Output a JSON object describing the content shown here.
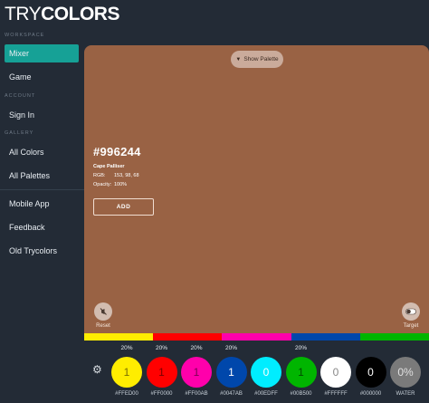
{
  "app": {
    "logo_part1": "TRY",
    "logo_part2": "COLORS"
  },
  "sidebar": {
    "sections": {
      "workspace": "WORKSPACE",
      "account": "ACCOUNT",
      "gallery": "GALLERY"
    },
    "items": [
      {
        "label": "Mixer",
        "active": true
      },
      {
        "label": "Game"
      },
      {
        "label": "Sign In"
      },
      {
        "label": "All Colors"
      },
      {
        "label": "All Palettes"
      },
      {
        "label": "Mobile App"
      },
      {
        "label": "Feedback"
      },
      {
        "label": "Old Trycolors"
      }
    ]
  },
  "card": {
    "bg_color": "#996244",
    "show_palette_label": "Show Palette",
    "hex": "#996244",
    "name": "Cape Palliser",
    "rgb_label": "RGB:",
    "rgb_value": "153, 98, 68",
    "opacity_label": "Opacity:",
    "opacity_value": "100%",
    "add_label": "ADD",
    "reset_label": "Reset",
    "target_label": "Target"
  },
  "strip_colors": [
    "#FFED00",
    "#FF0000",
    "#FF00AB",
    "#0047AB",
    "#00EDFF",
    "#00B500",
    "#FFFFFF"
  ],
  "swatches": [
    {
      "percent": "20%",
      "count": "1",
      "color": "#FFED00",
      "text_color": "#7a6f00",
      "hex": "#FFED00"
    },
    {
      "percent": "20%",
      "count": "1",
      "color": "#FF0000",
      "text_color": "#7a0000",
      "hex": "#FF0000"
    },
    {
      "percent": "20%",
      "count": "1",
      "color": "#FF00AB",
      "text_color": "#7a0052",
      "hex": "#FF00AB"
    },
    {
      "percent": "20%",
      "count": "1",
      "color": "#0047AB",
      "text_color": "#ffffff",
      "hex": "#0047AB"
    },
    {
      "percent": "",
      "count": "0",
      "color": "#00EDFF",
      "text_color": "#ffffff",
      "hex": "#00EDFF"
    },
    {
      "percent": "20%",
      "count": "1",
      "color": "#00B500",
      "text_color": "#004d00",
      "hex": "#00B500"
    },
    {
      "percent": "",
      "count": "0",
      "color": "#FFFFFF",
      "text_color": "#888888",
      "hex": "#FFFFFF"
    },
    {
      "percent": "",
      "count": "0",
      "color": "#000000",
      "text_color": "#ffffff",
      "hex": "#000000"
    },
    {
      "percent": "",
      "count": "0%",
      "color": "#7a7a7a",
      "text_color": "#e0e0e0",
      "hex": "WATER"
    }
  ],
  "icons": {
    "settings": "gear-icon",
    "reset": "reset-icon",
    "target": "toggle-icon",
    "show_palette": "chevron-down-icon"
  }
}
